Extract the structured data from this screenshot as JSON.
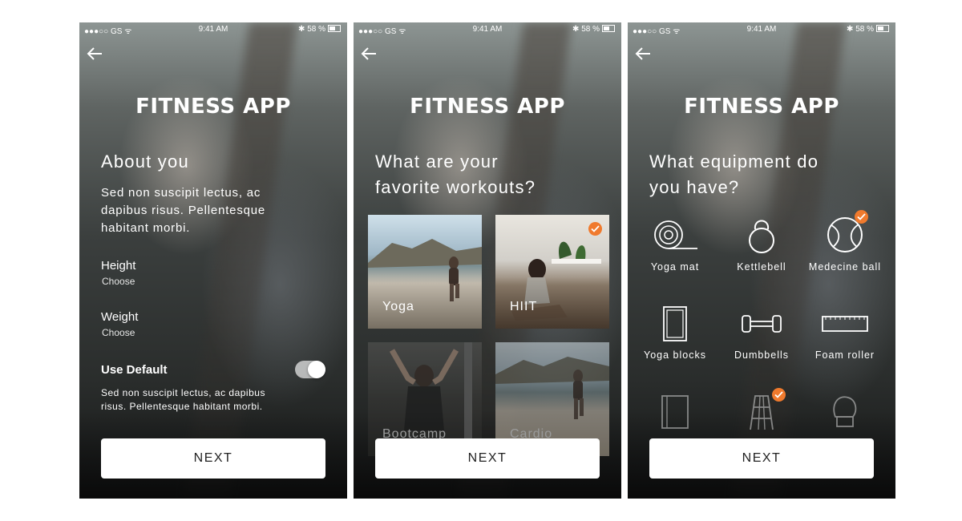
{
  "status": {
    "carrier": "●●●○○ GS ᯤ",
    "time": "9:41 AM",
    "battery": "58 %"
  },
  "app_title": "FITNESS APP",
  "screen1": {
    "heading": "About you",
    "description": "Sed non suscipit lectus, ac dapibus risus. Pellentesque habitant morbi.",
    "height_label": "Height",
    "height_value": "Choose",
    "weight_label": "Weight",
    "weight_value": "Choose",
    "use_default_label": "Use Default",
    "use_default_on": true,
    "small_description": "Sed non suscipit lectus, ac dapibus risus. Pellentesque habitant morbi.",
    "next_label": "NEXT"
  },
  "screen2": {
    "heading_line1": "What are your",
    "heading_line2": "favorite workouts?",
    "tiles": [
      {
        "label": "Yoga",
        "selected": false
      },
      {
        "label": "HIIT",
        "selected": true
      },
      {
        "label": "Bootcamp",
        "selected": false
      },
      {
        "label": "Cardio",
        "selected": false
      }
    ],
    "next_label": "NEXT"
  },
  "screen3": {
    "heading_line1": "What equipment do",
    "heading_line2": "you have?",
    "items": [
      {
        "label": "Yoga mat",
        "icon": "yoga-mat-icon",
        "selected": false
      },
      {
        "label": "Kettlebell",
        "icon": "kettlebell-icon",
        "selected": false
      },
      {
        "label": "Medecine ball",
        "icon": "medicine-ball-icon",
        "selected": true
      },
      {
        "label": "Yoga blocks",
        "icon": "yoga-blocks-icon",
        "selected": false
      },
      {
        "label": "Dumbbells",
        "icon": "dumbbell-icon",
        "selected": false
      },
      {
        "label": "Foam roller",
        "icon": "foam-roller-icon",
        "selected": false
      },
      {
        "label": "",
        "icon": "towel-icon",
        "selected": false
      },
      {
        "label": "",
        "icon": "ladder-icon",
        "selected": true
      },
      {
        "label": "",
        "icon": "boxing-glove-icon",
        "selected": false
      }
    ],
    "next_label": "NEXT"
  },
  "colors": {
    "accent": "#f07a2d",
    "button_bg": "#ffffff",
    "button_text": "#222222"
  }
}
